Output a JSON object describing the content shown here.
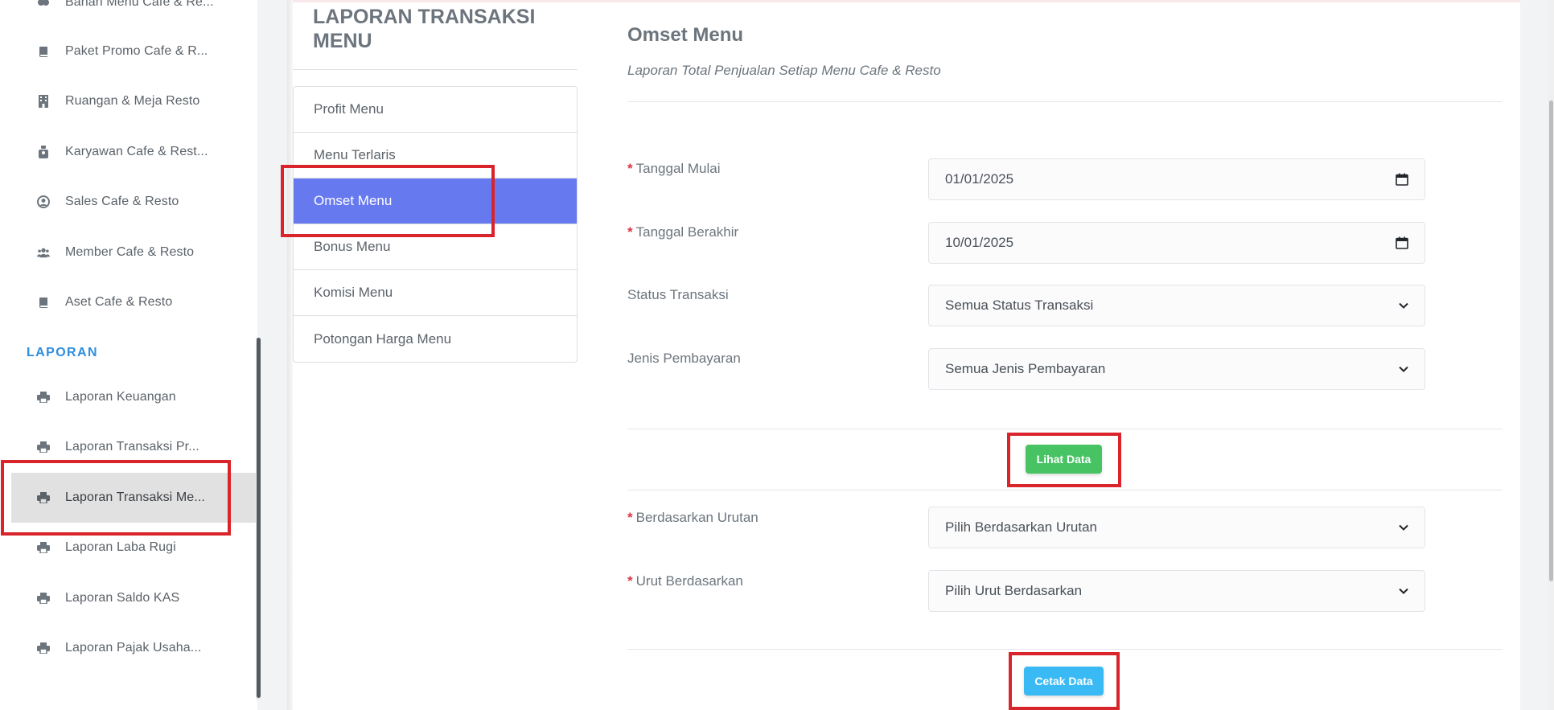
{
  "sidebar": {
    "partial_item": "Bahan Menu Cafe & Re...",
    "items_top": [
      {
        "label": "Paket Promo Cafe & R...",
        "icon": "book-icon"
      },
      {
        "label": "Ruangan & Meja Resto",
        "icon": "building-icon"
      },
      {
        "label": "Karyawan Cafe & Rest...",
        "icon": "employee-icon"
      },
      {
        "label": "Sales Cafe & Resto",
        "icon": "user-circle-icon"
      },
      {
        "label": "Member Cafe & Resto",
        "icon": "users-icon"
      },
      {
        "label": "Aset Cafe & Resto",
        "icon": "book-icon"
      }
    ],
    "section_label": "LAPORAN",
    "items_report": [
      {
        "label": "Laporan Keuangan",
        "icon": "print-icon"
      },
      {
        "label": "Laporan Transaksi Pr...",
        "icon": "print-icon"
      },
      {
        "label": "Laporan Transaksi Me...",
        "icon": "print-icon",
        "active": true
      },
      {
        "label": "Laporan Laba Rugi",
        "icon": "print-icon"
      },
      {
        "label": "Laporan Saldo KAS",
        "icon": "print-icon"
      },
      {
        "label": "Laporan Pajak Usaha...",
        "icon": "print-icon"
      }
    ]
  },
  "report": {
    "title": "LAPORAN TRANSAKSI MENU",
    "menu": [
      {
        "label": "Profit Menu"
      },
      {
        "label": "Menu Terlaris"
      },
      {
        "label": "Omset Menu",
        "active": true
      },
      {
        "label": "Bonus Menu"
      },
      {
        "label": "Komisi Menu"
      },
      {
        "label": "Potongan Harga Menu"
      }
    ]
  },
  "content": {
    "title": "Omset Menu",
    "subtitle": "Laporan Total Penjualan Setiap Menu Cafe & Resto",
    "required_mark": "*",
    "fields": {
      "tanggal_mulai": {
        "label": "Tanggal Mulai",
        "value": "01/01/2025"
      },
      "tanggal_berakhir": {
        "label": "Tanggal Berakhir",
        "value": "10/01/2025"
      },
      "status_transaksi": {
        "label": "Status Transaksi",
        "value": "Semua Status Transaksi"
      },
      "jenis_pembayaran": {
        "label": "Jenis Pembayaran",
        "value": "Semua Jenis Pembayaran"
      },
      "berdasarkan_urutan": {
        "label": "Berdasarkan Urutan",
        "value": "Pilih Berdasarkan Urutan"
      },
      "urut_berdasarkan": {
        "label": "Urut Berdasarkan",
        "value": "Pilih Urut Berdasarkan"
      }
    },
    "lihat_button": "Lihat Data",
    "cetak_button": "Cetak Data"
  },
  "colors": {
    "accent": "#6779ef",
    "section": "#2e8ddd",
    "green_button": "#47c363",
    "blue_button": "#3abaf4",
    "highlight": "#d9242b",
    "required": "#dc3545"
  }
}
